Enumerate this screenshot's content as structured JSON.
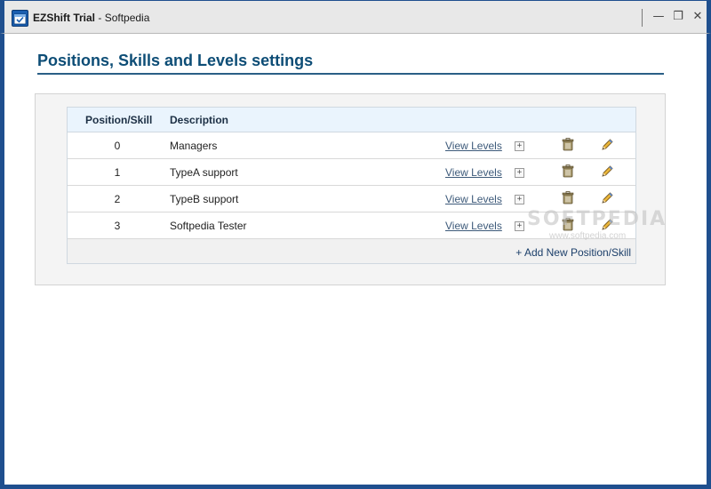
{
  "window": {
    "app_name": "EZShift Trial",
    "separator": " - ",
    "site": "Softpedia",
    "min_glyph": "—",
    "max_glyph": "❐",
    "close_glyph": "✕"
  },
  "page": {
    "title": "Positions, Skills and Levels settings"
  },
  "table": {
    "columns": [
      "Position/Skill",
      "Description"
    ],
    "view_label": "View Levels",
    "expand_glyph": "+",
    "rows": [
      {
        "id": "0",
        "description": "Managers"
      },
      {
        "id": "1",
        "description": "TypeA support"
      },
      {
        "id": "2",
        "description": "TypeB support"
      },
      {
        "id": "3",
        "description": "Softpedia Tester"
      }
    ],
    "add_label": "+ Add New Position/Skill"
  },
  "watermark": {
    "logo": "SOFTPEDIA",
    "url": "www.softpedia.com"
  },
  "colors": {
    "title_text": "#0d4d76",
    "header_bg": "#eaf4fd",
    "window_border": "#1f4f8e"
  },
  "icons": {
    "app": "calendar-check-icon",
    "delete": "trash-icon",
    "edit": "pencil-icon"
  }
}
